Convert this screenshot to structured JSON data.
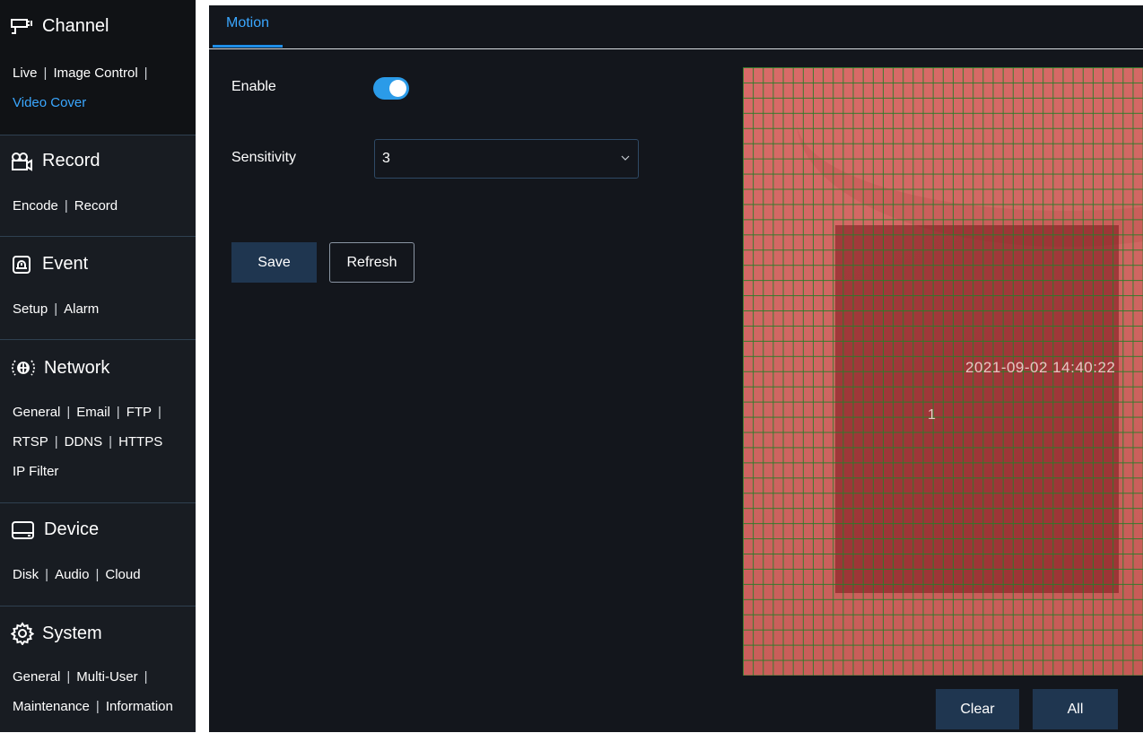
{
  "sidebar": {
    "sections": [
      {
        "title": "Channel",
        "icon": "camera-icon",
        "links": [
          "Live",
          "Image Control",
          "Video Cover"
        ],
        "active": "Video Cover"
      },
      {
        "title": "Record",
        "icon": "video-camera-icon",
        "links": [
          "Encode",
          "Record"
        ]
      },
      {
        "title": "Event",
        "icon": "alarm-icon",
        "links": [
          "Setup",
          "Alarm"
        ]
      },
      {
        "title": "Network",
        "icon": "network-globe-icon",
        "links": [
          "General",
          "Email",
          "FTP",
          "RTSP",
          "DDNS",
          "HTTPS",
          "IP Filter"
        ]
      },
      {
        "title": "Device",
        "icon": "hard-drive-icon",
        "links": [
          "Disk",
          "Audio",
          "Cloud"
        ]
      },
      {
        "title": "System",
        "icon": "gear-icon",
        "links": [
          "General",
          "Multi-User",
          "Maintenance",
          "Information"
        ]
      }
    ]
  },
  "main": {
    "tab": "Motion",
    "enable_label": "Enable",
    "enable_value": true,
    "sensitivity_label": "Sensitivity",
    "sensitivity_value": "3",
    "save_label": "Save",
    "refresh_label": "Refresh",
    "clear_label": "Clear",
    "all_label": "All",
    "video": {
      "timestamp": "2021-09-02 14:40:22",
      "channel_number": "1"
    }
  },
  "colors": {
    "accent": "#3aa7ff",
    "toggle_on": "#2b9be8",
    "button_bg": "#1f3650",
    "sidebar_bg": "#181c22",
    "grid_line": "#287d28",
    "motion_area": "#d96b68"
  }
}
